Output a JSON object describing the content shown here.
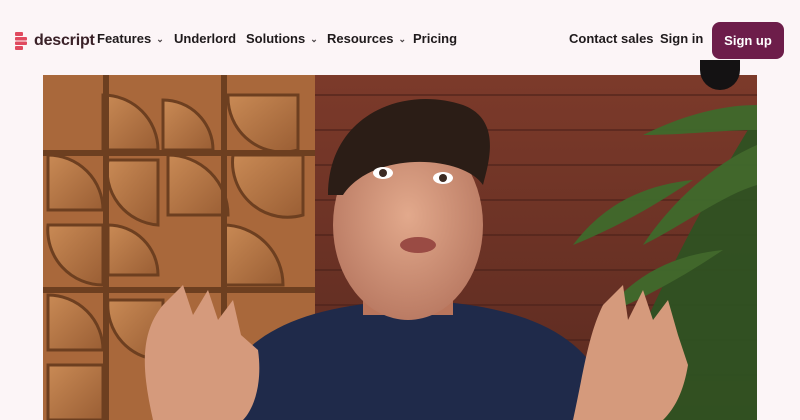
{
  "brand": {
    "name": "descript",
    "accent": "#e04a5f"
  },
  "nav": {
    "items": [
      {
        "label": "Features",
        "has_dropdown": true
      },
      {
        "label": "Underlord",
        "has_dropdown": false
      },
      {
        "label": "Solutions",
        "has_dropdown": true
      },
      {
        "label": "Resources",
        "has_dropdown": true
      },
      {
        "label": "Pricing",
        "has_dropdown": false
      }
    ],
    "contact_sales": "Contact sales",
    "sign_in": "Sign in",
    "sign_up": "Sign up",
    "chevron_glyph": "⌄"
  },
  "colors": {
    "primary_button": "#6d1d4a",
    "background": "#fcf5f7"
  }
}
